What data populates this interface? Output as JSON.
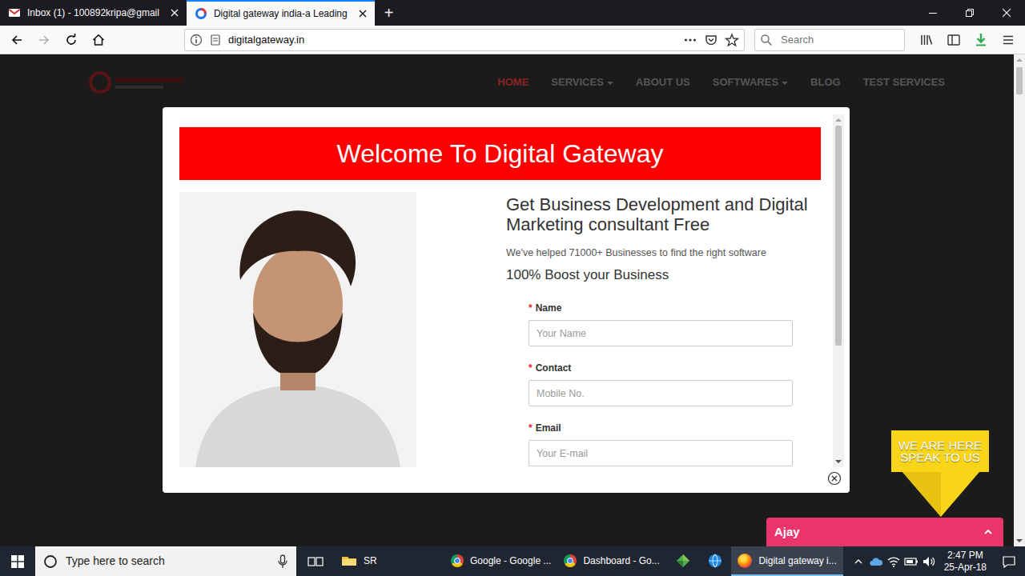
{
  "browser": {
    "tabs": [
      {
        "label": "Inbox (1) - 100892kripa@gmail",
        "kind": "mail",
        "selected": false
      },
      {
        "label": "Digital gateway india-a Leading",
        "kind": "site",
        "selected": true
      }
    ],
    "new_tab": "+",
    "address": "digitalgateway.in",
    "search": {
      "placeholder": "Search"
    }
  },
  "site": {
    "nav": [
      {
        "label": "HOME",
        "selected": true,
        "has_menu": false
      },
      {
        "label": "SERVICES",
        "selected": false,
        "has_menu": true
      },
      {
        "label": "ABOUT US",
        "selected": false,
        "has_menu": false
      },
      {
        "label": "SOFTWARES",
        "selected": false,
        "has_menu": true
      },
      {
        "label": "BLOG",
        "selected": false,
        "has_menu": false
      },
      {
        "label": "TEST SERVICES",
        "selected": false,
        "has_menu": false
      }
    ],
    "popup": {
      "title": "Welcome To Digital Gateway",
      "heading": "Get Business Development and Digital Marketing consultant Free",
      "subheading": "We've helped 71000+ Businesses to find the right software",
      "tagline": "100% Boost your Business",
      "required_mark": "*",
      "fields": [
        {
          "label": "Name",
          "required": true,
          "placeholder": "Your Name"
        },
        {
          "label": "Contact",
          "required": true,
          "placeholder": "Mobile No."
        },
        {
          "label": "Email",
          "required": true,
          "placeholder": "Your E-mail"
        }
      ]
    },
    "badge": {
      "lines": [
        "WE ARE HERE",
        "SPEAK TO US"
      ]
    },
    "chat": {
      "agent": "Ajay",
      "expanded": false
    }
  },
  "taskbar": {
    "search": {
      "text": "Type here to search"
    },
    "apps": [
      {
        "kind": "explorer",
        "label": "SR",
        "selected": false
      },
      {
        "kind": "chrome",
        "label": "Google - Google ...",
        "selected": false
      },
      {
        "kind": "chrome",
        "label": "Dashboard - Go...",
        "selected": false
      },
      {
        "kind": "diamond",
        "selected": false
      },
      {
        "kind": "globe",
        "selected": false
      },
      {
        "kind": "firefox",
        "label": "Digital gateway i...",
        "selected": true
      }
    ],
    "time": "2:47 PM",
    "date": "25-Apr-18"
  }
}
